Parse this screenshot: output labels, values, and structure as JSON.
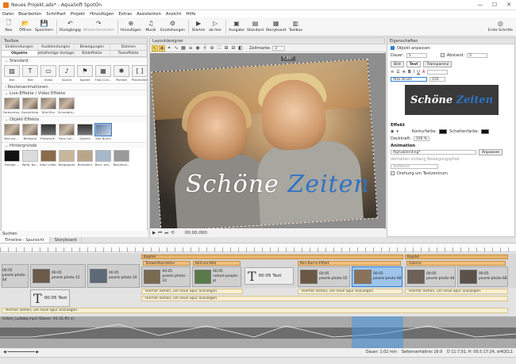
{
  "window": {
    "title": "Neues Projekt.ads* - AquaSoft SpotOn",
    "controls": [
      "—",
      "☐",
      "✕"
    ]
  },
  "menu": [
    "Datei",
    "Bearbeiten",
    "Schriftart",
    "Projekt",
    "Hinzufügen",
    "Extras",
    "Assistenten",
    "Ansicht",
    "Hilfe"
  ],
  "toolbar": [
    {
      "name": "neu",
      "label": "Neu",
      "icon": "🗋"
    },
    {
      "name": "oeffnen",
      "label": "Öffnen",
      "icon": "📂"
    },
    {
      "name": "speichern",
      "label": "Speichern",
      "icon": "💾"
    },
    {
      "name": "rueckgaengig",
      "label": "Rückgängig",
      "icon": "↶"
    },
    {
      "name": "wiederherstellen",
      "label": "Wiederherstellen",
      "icon": "↷",
      "disabled": true
    },
    {
      "name": "hinzufuegen",
      "label": "Hinzufügen",
      "icon": "⊕"
    },
    {
      "name": "musik",
      "label": "Musik",
      "icon": "♫"
    },
    {
      "name": "einstellungen",
      "label": "Einstellungen",
      "icon": "⚙"
    },
    {
      "name": "starten",
      "label": "Starten",
      "icon": "▶"
    },
    {
      "name": "ab-hier",
      "label": "ab hier",
      "icon": "▷"
    },
    {
      "name": "ausgabe",
      "label": "Ausgabe",
      "icon": "▣"
    },
    {
      "name": "standard",
      "label": "Standard",
      "icon": "▤"
    },
    {
      "name": "storyboard",
      "label": "Storyboard",
      "icon": "▦"
    },
    {
      "name": "toolbox",
      "label": "Toolbox",
      "icon": "▥"
    },
    {
      "name": "erste-schritte",
      "label": "Erste Schritte",
      "icon": "◎"
    }
  ],
  "toolbox": {
    "title": "Toolbox",
    "tabs_row1": [
      "Einblendungen",
      "Ausblendungen",
      "Bewegungen",
      "Dateien"
    ],
    "tabs_row2": [
      "Objekte",
      "Jetztfertige Vorlagen",
      "Bildeffekte",
      "Texteffekte"
    ],
    "sections": [
      {
        "title": "Standard",
        "items": [
          "Bild",
          "Text",
          "Video",
          "Sound",
          "Kapitel",
          "Flexi-Coll...",
          "Partikel",
          "Platzhalter"
        ]
      },
      {
        "title": "Routenanimationen",
        "collapsed": true
      },
      {
        "title": "Live-Effekte / Video Effekte",
        "items": [
          "Farbverlau...",
          "Duka/Hinte...",
          "Bild-Film",
          "Schreibtis..."
        ]
      },
      {
        "title": "Objekt-Effekte",
        "items": [
          "Bild-vor-...",
          "Bildkarte",
          "Filmstreif...",
          "Foto-Coll...",
          "Galerie",
          "Ken Burns"
        ]
      },
      {
        "title": "Hintergründe",
        "items": [
          "Farbige ...",
          "Weiß, Na...",
          "Alter Leder...",
          "Bergpapier",
          "Beroidern",
          "Blau, wei...",
          "Blockmal...",
          "Bleierflä..."
        ]
      }
    ]
  },
  "layout": {
    "title": "Layoutdesigner",
    "zoom_label": "Zeitmarke:",
    "zoom_value": "2",
    "rotation": "7,85°",
    "title_word1": "Schöne",
    "title_word2": "Zeiten",
    "timecode": "00:00.000"
  },
  "props": {
    "title": "Eigenschaften",
    "auto_label": "Objekt anpassen",
    "dauer_label": "Dauer:",
    "dauer_value": "5",
    "abstand_label": "Abstand:",
    "abstand_value": "5",
    "tabs": [
      "Bild",
      "Text",
      "Transparenz"
    ],
    "font": "Alex Brush",
    "fontsize": "150",
    "preview_word1": "Schöne",
    "preview_word2": "Zeiten",
    "effekt_title": "Effekt",
    "kontur_label": "Konturfarbe:",
    "schatten_label": "Schattenfarbe:",
    "deckkraft_label": "Deckkraft:",
    "deckkraft_value": "100 %",
    "animation_title": "Animation",
    "animation_value": "Alphablending*",
    "anpassen_label": "Anpassen",
    "verlauf_label": "Verhalten entlang Bewegungspfad:",
    "verlauf_value": "Textblock",
    "drehung_label": "Drehung um Textzentrum"
  },
  "timeline": {
    "tabs": [
      "Timeline - Spursicht",
      "Storyboard"
    ],
    "search_label": "Suchen",
    "clips_top": [
      {
        "label": "pexels-photo-44",
        "dur": "00:05"
      },
      {
        "label": "pexels-photo-12",
        "dur": "00:05"
      },
      {
        "label": "pexels-photo-10",
        "dur": "00:05"
      },
      {
        "label": "pexels-photo-22",
        "dur": "00:05"
      },
      {
        "label": "nature-people-pl",
        "dur": "00:05"
      },
      {
        "label": "Text",
        "dur": "00:05"
      },
      {
        "label": "pexels-photo-55",
        "dur": "00:05"
      },
      {
        "label": "pexels-photo-68",
        "dur": "00:05"
      },
      {
        "label": "pexels-photo-44",
        "dur": "00:05"
      },
      {
        "label": "pexels-photo-68",
        "dur": "00:05"
      }
    ],
    "chapters": [
      "Kapitel",
      "Kapitel",
      "Kapitel"
    ],
    "effect_names": [
      "Tonwertkorrektur",
      "Bild-vor-Bild",
      "Ken-Burns-Effekt",
      "Galerie"
    ],
    "hint": "Hierher ziehen, um neue Spur anzulegen.",
    "text_clip": {
      "label": "Text",
      "dur": "00:05"
    },
    "audio_label": "Urban_Lullaby.mp3 (Dauer: 01:31,91 s)",
    "status_left": "Dauer: 1:02 min",
    "status_mid": "Seitenverhältnis 16:9",
    "status_right": "D 11:7,01, H: 00.5:17:24, st4QCL1"
  }
}
